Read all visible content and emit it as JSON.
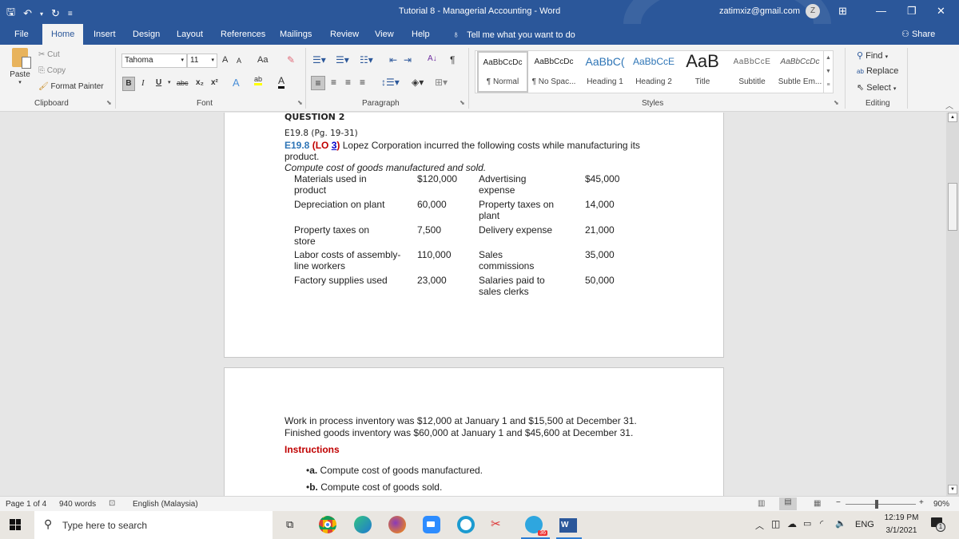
{
  "window": {
    "title": "Tutorial 8 - Managerial Accounting  -  Word",
    "account": "zatimxiz@gmail.com",
    "avatar_letter": "Z",
    "minimize": "—",
    "restore": "❐",
    "close": "✕",
    "ribbon_display": "⊞"
  },
  "quick_access": {
    "save": "🖫",
    "undo": "↶",
    "undo_dropdown": "▾",
    "redo": "↻",
    "customize": "≡"
  },
  "tabs": [
    {
      "label": "File"
    },
    {
      "label": "Home"
    },
    {
      "label": "Insert"
    },
    {
      "label": "Design"
    },
    {
      "label": "Layout"
    },
    {
      "label": "References"
    },
    {
      "label": "Mailings"
    },
    {
      "label": "Review"
    },
    {
      "label": "View"
    },
    {
      "label": "Help"
    }
  ],
  "tell_me": "Tell me what you want to do",
  "share": "Share",
  "clipboard": {
    "paste": "Paste",
    "cut": "Cut",
    "copy": "Copy",
    "format_painter": "Format Painter",
    "label": "Clipboard"
  },
  "font": {
    "name": "Tahoma",
    "size": "11",
    "grow": "A",
    "shrink": "A",
    "case": "Aa",
    "bold": "B",
    "italic": "I",
    "underline": "U",
    "strike": "abc",
    "subscript": "x₂",
    "superscript": "x²",
    "effects": "A",
    "highlight": "ab",
    "color": "A",
    "label": "Font",
    "highlight_color": "#ffff00",
    "font_color": "#000000"
  },
  "paragraph": {
    "label": "Paragraph",
    "sort": "A↓",
    "pilcrow": "¶"
  },
  "styles": {
    "label": "Styles",
    "items": [
      {
        "preview": "AaBbCcDc",
        "name": "¶ Normal"
      },
      {
        "preview": "AaBbCcDc",
        "name": "¶ No Spac..."
      },
      {
        "preview": "AaBbC(",
        "name": "Heading 1"
      },
      {
        "preview": "AaBbCcE",
        "name": "Heading 2"
      },
      {
        "preview": "AaB",
        "name": "Title"
      },
      {
        "preview": "AaBbCcE",
        "name": "Subtitle"
      },
      {
        "preview": "AaBbCcDc",
        "name": "Subtle Em..."
      }
    ]
  },
  "editing": {
    "find": "Find",
    "replace": "Replace",
    "select": "Select",
    "label": "Editing"
  },
  "document": {
    "heading": "QUESTION 2",
    "ref": "E19.8 (Pg. 19-31)",
    "ex_id": "E19.8",
    "lo_open": "(LO ",
    "lo_num": "3",
    "lo_close": ")",
    "intro": " Lopez Corporation incurred the following costs while manufacturing its",
    "intro2": "product.",
    "task": "Compute cost of goods manufactured and sold.",
    "costs": [
      {
        "label": "Materials used in product",
        "value": "$120,000",
        "label2": "Advertising expense",
        "value2": "$45,000"
      },
      {
        "label": "Depreciation on plant",
        "value": "60,000",
        "label2": "Property taxes on plant",
        "value2": "14,000"
      },
      {
        "label": "Property taxes on store",
        "value": "7,500",
        "label2": "Delivery expense",
        "value2": "21,000"
      },
      {
        "label": "Labor costs of assembly-line workers",
        "value": "110,000",
        "label2": "Sales commissions",
        "value2": "35,000"
      },
      {
        "label": "Factory supplies used",
        "value": "23,000",
        "label2": "Salaries paid to sales clerks",
        "value2": "50,000"
      }
    ],
    "wip": "Work in process inventory was $12,000 at January 1 and $15,500 at December 31.",
    "fg": "Finished goods inventory was $60,000 at January 1 and $45,600 at December 31.",
    "instructions_title": "Instructions",
    "instr": [
      {
        "letter": "a.",
        "text": " Compute cost of goods manufactured."
      },
      {
        "letter": "b.",
        "text": " Compute cost of goods sold."
      }
    ],
    "colors": {
      "blue": "#2e75b6",
      "red": "#c00000"
    }
  },
  "status": {
    "page": "Page 1 of 4",
    "words": "940 words",
    "language": "English (Malaysia)",
    "zoom": "90%",
    "zoom_minus": "−",
    "zoom_plus": "+",
    "zoom_level_percent": 90
  },
  "taskbar": {
    "search_placeholder": "Type here to search",
    "time": "12:19 PM",
    "date": "3/1/2021",
    "lang": "ENG",
    "telegram_badge": "36",
    "notification_count": "1"
  }
}
